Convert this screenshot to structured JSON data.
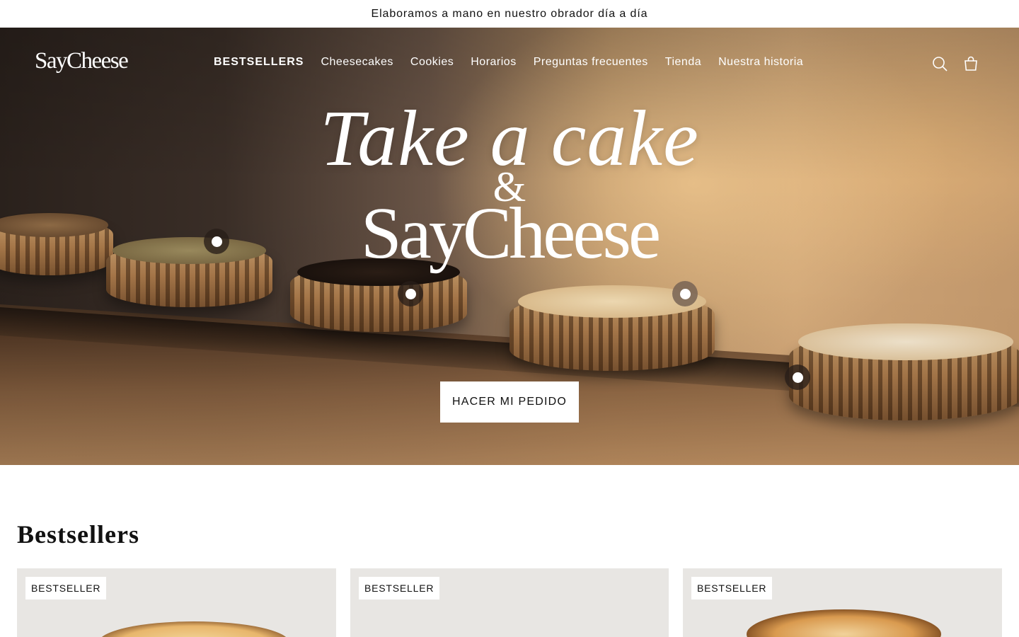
{
  "announcement": "Elaboramos a mano en nuestro obrador día a día",
  "header": {
    "logo": "SayCheese",
    "nav": [
      {
        "label": "BESTSELLERS"
      },
      {
        "label": "Cheesecakes"
      },
      {
        "label": "Cookies"
      },
      {
        "label": "Horarios"
      },
      {
        "label": "Preguntas frecuentes"
      },
      {
        "label": "Tienda"
      },
      {
        "label": "Nuestra historia"
      }
    ],
    "icons": [
      "search-icon",
      "shopping-bag-icon"
    ]
  },
  "hero": {
    "title_line1": "Take a cake",
    "ampersand": "&",
    "title_line2": "SayCheese",
    "cta_label": "HACER MI PEDIDO",
    "hotspot_count": 4
  },
  "bestsellers": {
    "title": "Bestsellers",
    "cards": [
      {
        "badge": "BESTSELLER"
      },
      {
        "badge": "BESTSELLER"
      },
      {
        "badge": "BESTSELLER"
      }
    ]
  },
  "colors": {
    "text": "#111111",
    "white": "#ffffff",
    "card_bg": "#e8e6e3",
    "hotspot_bg": "#2a1e18"
  }
}
